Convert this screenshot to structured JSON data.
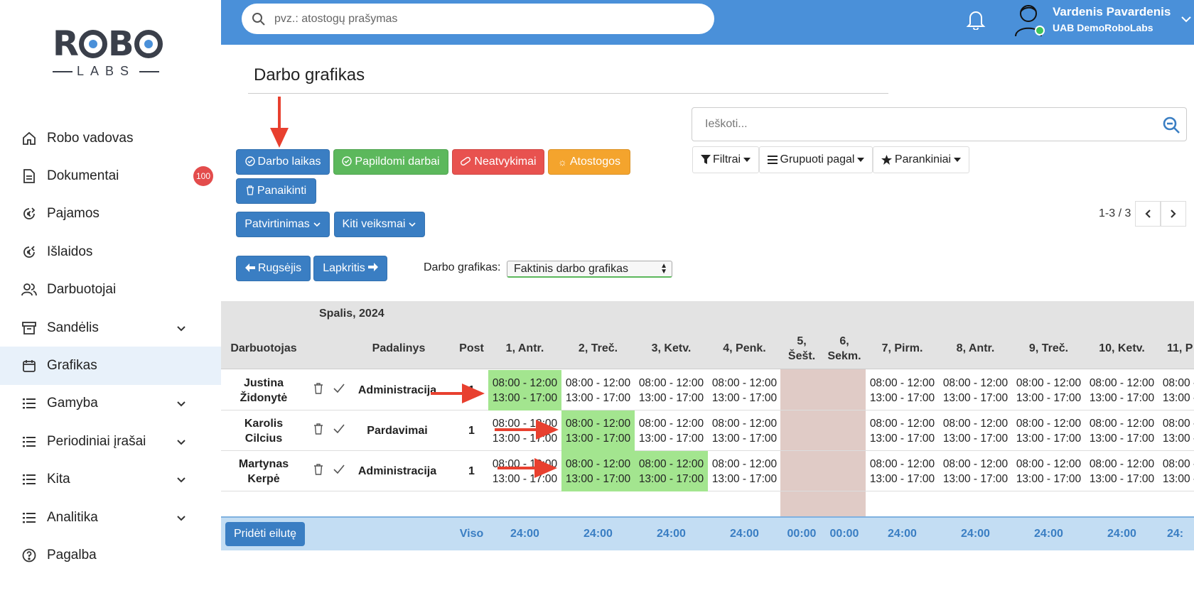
{
  "logo": {
    "top": "ROBO",
    "bottom": "LABS"
  },
  "sidebar": {
    "items": [
      {
        "label": "Robo vadovas",
        "icon": "home-icon"
      },
      {
        "label": "Dokumentai",
        "icon": "document-icon",
        "badge": "100"
      },
      {
        "label": "Pajamos",
        "icon": "euro-in-icon"
      },
      {
        "label": "Išlaidos",
        "icon": "euro-out-icon"
      },
      {
        "label": "Darbuotojai",
        "icon": "users-icon"
      },
      {
        "label": "Sandėlis",
        "icon": "archive-icon",
        "expandable": true
      },
      {
        "label": "Grafikas",
        "icon": "calendar-icon",
        "active": true
      },
      {
        "label": "Gamyba",
        "icon": "list-icon",
        "expandable": true
      },
      {
        "label": "Periodiniai įrašai",
        "icon": "list-icon",
        "expandable": true
      },
      {
        "label": "Kita",
        "icon": "list-icon",
        "expandable": true
      },
      {
        "label": "Analitika",
        "icon": "list-icon",
        "expandable": true
      },
      {
        "label": "Pagalba",
        "icon": "help-icon"
      }
    ]
  },
  "topbar": {
    "search_placeholder": "pvz.: atostogų prašymas",
    "user_name": "Vardenis Pavardenis",
    "user_company": "UAB DemoRoboLabs"
  },
  "page": {
    "title": "Darbo grafikas",
    "search_placeholder": "Ieškoti...",
    "buttons": {
      "work_time": "Darbo laikas",
      "extra_work": "Papildomi darbai",
      "absences": "Neatvykimai",
      "vacation": "Atostogos",
      "delete": "Panaikinti",
      "confirmation": "Patvirtinimas",
      "other_actions": "Kiti veiksmai",
      "prev_month": "Rugsėjis",
      "next_month": "Lapkritis"
    },
    "filters": {
      "filters": "Filtrai",
      "group_by": "Grupuoti pagal",
      "favorites": "Parankiniai"
    },
    "pager": "1-3 / 3",
    "schedule_label": "Darbo grafikas:",
    "schedule_value": "Faktinis darbo grafikas"
  },
  "table": {
    "month": "Spalis, 2024",
    "headers": {
      "employee": "Darbuotojas",
      "department": "Padalinys",
      "post": "Post"
    },
    "days": [
      {
        "label": "1, Antr."
      },
      {
        "label": "2, Treč."
      },
      {
        "label": "3, Ketv."
      },
      {
        "label": "4, Penk."
      },
      {
        "label": "5, Šešt.",
        "weekend": true
      },
      {
        "label": "6, Sekm.",
        "weekend": true
      },
      {
        "label": "7, Pirm."
      },
      {
        "label": "8, Antr."
      },
      {
        "label": "9, Treč."
      },
      {
        "label": "10, Ketv."
      },
      {
        "label": "11, P"
      }
    ],
    "rows": [
      {
        "first": "Justina",
        "last": "Židonytė",
        "department": "Administracija",
        "post": "1",
        "green": [
          0
        ]
      },
      {
        "first": "Karolis",
        "last": "Cilcius",
        "department": "Pardavimai",
        "post": "1",
        "green": [
          1
        ]
      },
      {
        "first": "Martynas",
        "last": "Kerpė",
        "department": "Administracija",
        "post": "1",
        "green": [
          1,
          2
        ]
      }
    ],
    "shift_am": "08:00 - 12:00",
    "shift_pm": "13:00 - 17:00",
    "totals_label": "Viso",
    "totals": [
      "24:00",
      "24:00",
      "24:00",
      "24:00",
      "00:00",
      "00:00",
      "24:00",
      "24:00",
      "24:00",
      "24:00",
      "24:"
    ],
    "add_row": "Pridėti eilutę"
  },
  "colors": {
    "primary": "#3a7ec3",
    "topbar": "#4a90d9",
    "green_cell": "#a3e58f",
    "weekend": "#e0cbc6",
    "annotation_arrow": "#e8402f"
  }
}
